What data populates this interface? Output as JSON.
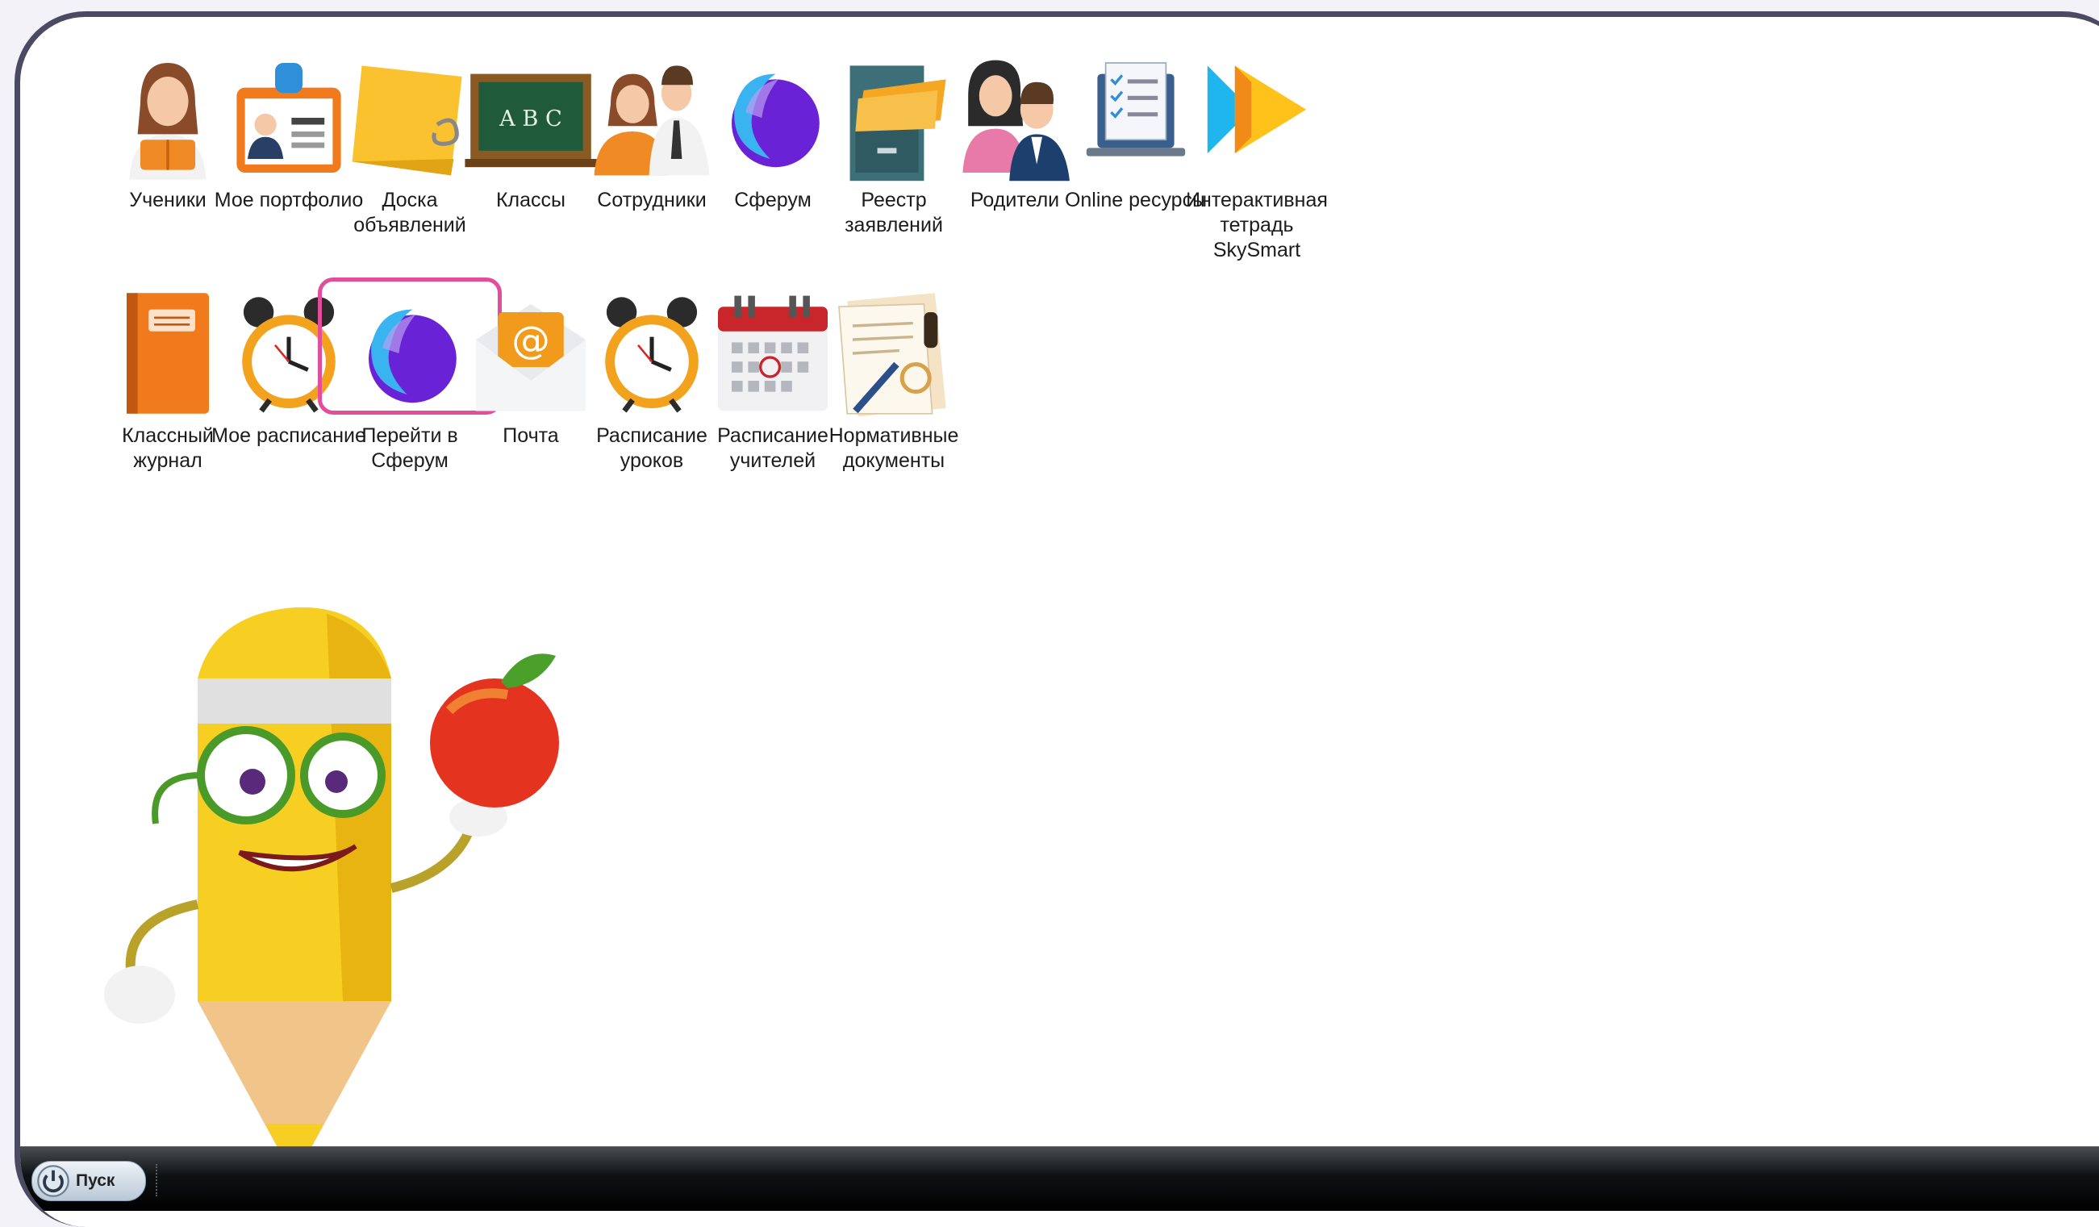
{
  "desktop": {
    "row1": [
      {
        "label": "Ученики",
        "icon": "student-icon"
      },
      {
        "label": "Мое портфолио",
        "icon": "portfolio-icon"
      },
      {
        "label": "Доска\nобъявлений",
        "icon": "notice-board-icon"
      },
      {
        "label": "Классы",
        "icon": "chalkboard-icon"
      },
      {
        "label": "Сотрудники",
        "icon": "staff-icon"
      },
      {
        "label": "Сферум",
        "icon": "sferum-icon"
      },
      {
        "label": "Реестр\nзаявлений",
        "icon": "file-cabinet-icon"
      },
      {
        "label": "Родители",
        "icon": "parents-icon"
      },
      {
        "label": "Online ресурсы",
        "icon": "online-resources-icon"
      },
      {
        "label": "Интерактивная\nтетрадь\nSkySmart",
        "icon": "skysmart-icon"
      }
    ],
    "row2": [
      {
        "label": "Классный\nжурнал",
        "icon": "class-journal-icon"
      },
      {
        "label": "Мое расписание",
        "icon": "alarm-clock-icon"
      },
      {
        "label": "Перейти в\nСферум",
        "icon": "sferum-icon",
        "selected": true
      },
      {
        "label": "Почта",
        "icon": "mail-icon"
      },
      {
        "label": "Расписание\nуроков",
        "icon": "alarm-clock-icon"
      },
      {
        "label": "Расписание\nучителей",
        "icon": "calendar-icon"
      },
      {
        "label": "Нормативные\nдокументы",
        "icon": "documents-stamp-icon"
      }
    ]
  },
  "taskbar": {
    "start_label": "Пуск"
  },
  "colors": {
    "selection": "#e24d9c",
    "frame": "#4a4a62",
    "sferum_purple": "#6a22d6",
    "sferum_blue": "#3ab4f0"
  }
}
